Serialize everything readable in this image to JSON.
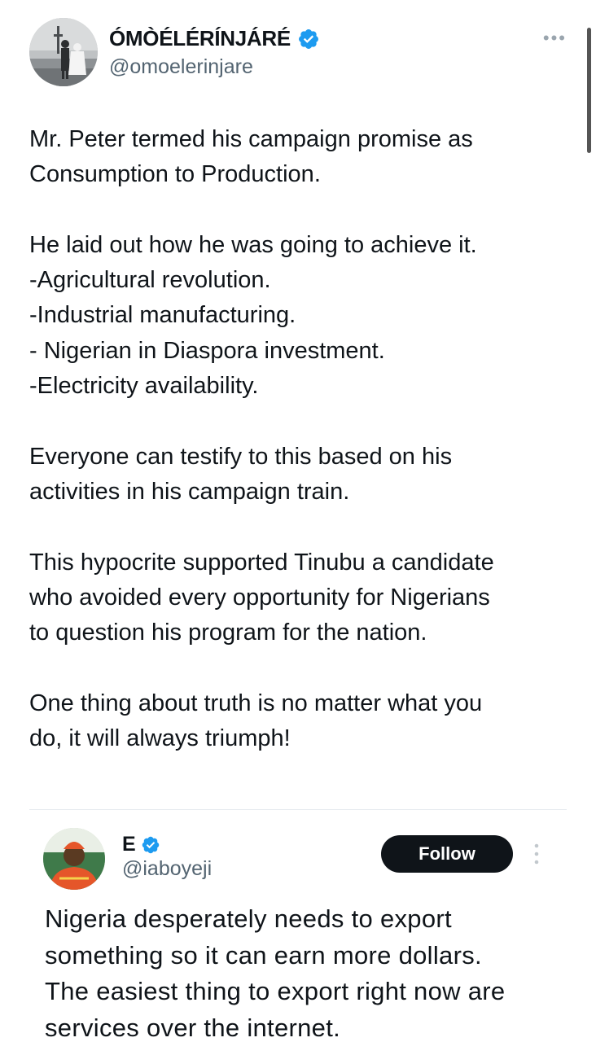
{
  "tweet": {
    "author": {
      "display_name": "ÓMÒÉLÉRÍNJÁRÉ",
      "handle": "@omoelerinjare",
      "verified": true,
      "avatar_icon": "profile-photo-two-men-black-and-white"
    },
    "more_icon": "more-horizontal-icon",
    "more_symbol": "•••",
    "paragraphs": [
      "Mr. Peter termed his campaign promise as\nConsumption to Production.",
      "He laid out how he was going to achieve it.\n-Agricultural revolution.\n-Industrial manufacturing.\n- Nigerian in Diaspora investment.\n-Electricity availability.",
      "Everyone can testify to this based on his\nactivities in his campaign train.",
      "This hypocrite supported Tinubu a candidate\nwho avoided every opportunity for Nigerians\nto question his program for the nation.",
      "One thing about truth is no matter what you\ndo, it will always triumph!"
    ]
  },
  "quoted_tweet": {
    "author": {
      "display_name": "E",
      "handle": "@iaboyeji",
      "verified": true,
      "avatar_icon": "profile-photo-man-in-orange-attire"
    },
    "follow_label": "Follow",
    "more_icon": "more-vertical-icon",
    "text": "Nigeria desperately needs to export\nsomething so it can earn more dollars.\nThe easiest thing to export right now are\nservices over the internet."
  },
  "colors": {
    "text_primary": "#0f1419",
    "text_secondary": "#536471",
    "verified_blue": "#1d9bf0",
    "follow_button_bg": "#0f1419",
    "divider": "#e6ebef"
  }
}
